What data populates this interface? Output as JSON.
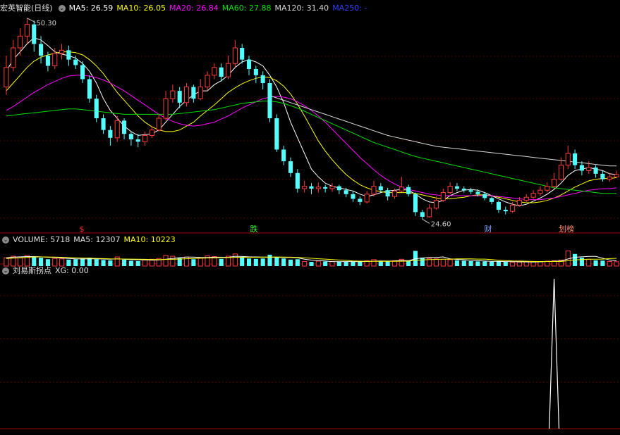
{
  "price_panel": {
    "title": "宏英智能(日线)",
    "indicators": [
      {
        "label": "MA5: 26.59",
        "color": "#ffffff"
      },
      {
        "label": "MA10: 26.05",
        "color": "#ffff00"
      },
      {
        "label": "MA20: 26.84",
        "color": "#ff00ff"
      },
      {
        "label": "MA60: 27.88",
        "color": "#00e000"
      },
      {
        "label": "MA120: 31.40",
        "color": "#d8d8d8"
      },
      {
        "label": "MA250: -",
        "color": "#3040ff"
      }
    ],
    "max_label": "50.30",
    "min_label": "24.60",
    "event_markers": [
      "$",
      "跌",
      "财",
      "划榜"
    ]
  },
  "volume_panel": {
    "title": "VOLUME: 5718",
    "ma5": "MA5: 12307",
    "ma10": "MA10: 10223"
  },
  "indicator_panel": {
    "title": "刘易斯拐点",
    "value": "XG: 0.00"
  },
  "chart_data": {
    "type": "candlestick",
    "ylim": [
      24,
      51
    ],
    "candles": [
      [
        41.5,
        44.0,
        45.5,
        40.5
      ],
      [
        44.0,
        46.5,
        47.5,
        43.5
      ],
      [
        46.5,
        48.0,
        49.0,
        45.5
      ],
      [
        48.0,
        49.5,
        50.3,
        47.0
      ],
      [
        49.5,
        47.0,
        50.0,
        46.0
      ],
      [
        47.0,
        45.5,
        48.0,
        44.5
      ],
      [
        45.5,
        44.2,
        46.0,
        43.5
      ],
      [
        44.2,
        45.8,
        46.5,
        43.8
      ],
      [
        45.8,
        46.2,
        47.0,
        45.0
      ],
      [
        46.2,
        45.0,
        46.8,
        44.2
      ],
      [
        45.0,
        44.3,
        45.5,
        43.8
      ],
      [
        44.3,
        42.5,
        44.8,
        42.0
      ],
      [
        42.5,
        40.0,
        43.0,
        39.5
      ],
      [
        40.0,
        37.5,
        40.5,
        37.0
      ],
      [
        37.5,
        36.0,
        38.0,
        35.5
      ],
      [
        36.0,
        35.0,
        36.5,
        34.0
      ],
      [
        35.0,
        37.2,
        37.8,
        34.5
      ],
      [
        37.2,
        35.5,
        37.5,
        34.8
      ],
      [
        35.5,
        34.8,
        35.8,
        34.0
      ],
      [
        34.8,
        34.5,
        35.5,
        33.8
      ],
      [
        34.5,
        35.3,
        35.8,
        34.0
      ],
      [
        35.3,
        36.0,
        36.5,
        35.0
      ],
      [
        36.0,
        37.5,
        38.0,
        35.8
      ],
      [
        37.5,
        40.0,
        41.0,
        37.2
      ],
      [
        40.0,
        41.0,
        41.8,
        39.5
      ],
      [
        41.0,
        39.5,
        41.5,
        38.8
      ],
      [
        39.5,
        41.5,
        42.0,
        39.0
      ],
      [
        41.5,
        40.0,
        41.8,
        39.5
      ],
      [
        40.0,
        41.5,
        42.5,
        39.8
      ],
      [
        41.5,
        43.0,
        43.5,
        41.0
      ],
      [
        43.0,
        44.0,
        44.5,
        42.5
      ],
      [
        44.0,
        42.8,
        44.5,
        42.2
      ],
      [
        42.8,
        44.5,
        45.5,
        42.5
      ],
      [
        44.5,
        46.5,
        47.5,
        44.0
      ],
      [
        46.5,
        45.0,
        47.0,
        44.5
      ],
      [
        45.0,
        43.8,
        45.5,
        43.0
      ],
      [
        43.8,
        43.0,
        44.2,
        42.0
      ],
      [
        43.0,
        42.0,
        43.5,
        41.2
      ],
      [
        42.0,
        37.5,
        42.5,
        37.0
      ],
      [
        37.5,
        33.5,
        38.0,
        33.2
      ],
      [
        33.5,
        32.0,
        34.0,
        31.5
      ],
      [
        32.0,
        30.5,
        32.5,
        30.0
      ],
      [
        30.5,
        28.5,
        31.0,
        28.0
      ],
      [
        28.5,
        28.8,
        29.5,
        28.0
      ],
      [
        28.8,
        28.5,
        29.2,
        27.8
      ],
      [
        28.5,
        28.7,
        29.3,
        28.0
      ],
      [
        28.7,
        28.5,
        29.0,
        28.0
      ],
      [
        28.5,
        28.8,
        29.2,
        28.1
      ],
      [
        28.8,
        28.3,
        29.0,
        27.8
      ],
      [
        28.3,
        27.8,
        28.6,
        27.4
      ],
      [
        27.8,
        27.2,
        28.2,
        26.8
      ],
      [
        27.2,
        26.8,
        27.5,
        26.4
      ],
      [
        26.8,
        27.8,
        28.2,
        26.6
      ],
      [
        27.8,
        28.8,
        29.5,
        27.5
      ],
      [
        28.8,
        28.3,
        29.2,
        28.0
      ],
      [
        28.3,
        27.5,
        28.6,
        27.0
      ],
      [
        27.5,
        28.2,
        28.5,
        27.2
      ],
      [
        28.2,
        28.7,
        30.0,
        28.0
      ],
      [
        28.7,
        27.8,
        29.0,
        27.5
      ],
      [
        27.8,
        25.5,
        28.0,
        25.0
      ],
      [
        25.5,
        24.9,
        25.8,
        24.6
      ],
      [
        24.9,
        26.0,
        26.5,
        24.8
      ],
      [
        26.0,
        27.0,
        27.5,
        25.8
      ],
      [
        27.0,
        28.0,
        28.5,
        26.8
      ],
      [
        28.0,
        28.8,
        29.3,
        27.8
      ],
      [
        28.8,
        28.5,
        29.2,
        28.2
      ],
      [
        28.5,
        28.3,
        28.8,
        28.0
      ],
      [
        28.3,
        28.1,
        28.6,
        27.8
      ],
      [
        28.1,
        27.8,
        28.4,
        27.5
      ],
      [
        27.8,
        27.3,
        28.0,
        27.0
      ],
      [
        27.3,
        26.8,
        27.5,
        26.5
      ],
      [
        26.8,
        25.8,
        27.0,
        25.4
      ],
      [
        25.8,
        25.6,
        26.2,
        25.2
      ],
      [
        25.6,
        26.4,
        26.8,
        25.4
      ],
      [
        26.4,
        27.0,
        27.4,
        26.2
      ],
      [
        27.0,
        27.4,
        27.8,
        26.8
      ],
      [
        27.4,
        27.9,
        28.3,
        27.2
      ],
      [
        27.9,
        28.3,
        28.8,
        27.6
      ],
      [
        28.3,
        28.8,
        29.3,
        28.0
      ],
      [
        28.8,
        29.7,
        30.5,
        28.5
      ],
      [
        29.7,
        31.5,
        32.5,
        29.5
      ],
      [
        31.5,
        33.0,
        34.0,
        31.0
      ],
      [
        33.0,
        31.5,
        33.5,
        31.0
      ],
      [
        31.5,
        30.8,
        32.0,
        30.2
      ],
      [
        30.8,
        31.2,
        32.0,
        30.4
      ],
      [
        31.2,
        30.4,
        31.5,
        29.9
      ],
      [
        30.4,
        29.7,
        30.8,
        29.4
      ],
      [
        29.7,
        30.0,
        30.5,
        29.4
      ],
      [
        30.0,
        30.3,
        30.8,
        29.9
      ]
    ],
    "ma": {
      "MA5": [
        43.5,
        45.0,
        46.0,
        47.0,
        47.8,
        47.5,
        46.8,
        46.0,
        45.7,
        45.5,
        45.2,
        44.5,
        43.5,
        42.0,
        40.0,
        38.5,
        37.5,
        36.5,
        35.8,
        35.3,
        35.4,
        35.5,
        36.0,
        37.0,
        38.0,
        39.0,
        39.8,
        40.5,
        41.0,
        41.0,
        41.8,
        42.3,
        43.0,
        44.0,
        44.7,
        45.0,
        44.7,
        44.2,
        43.0,
        41.5,
        39.5,
        37.0,
        35.0,
        33.0,
        31.0,
        30.0,
        29.2,
        28.8,
        28.6,
        28.4,
        28.2,
        27.8,
        27.5,
        27.7,
        28.0,
        28.2,
        28.3,
        28.4,
        28.3,
        27.8,
        27.2,
        26.8,
        26.7,
        27.0,
        27.6,
        28.0,
        28.3,
        28.4,
        28.3,
        28.0,
        27.6,
        27.2,
        26.8,
        26.5,
        26.3,
        26.5,
        26.9,
        27.3,
        27.8,
        28.4,
        29.2,
        30.2,
        30.8,
        31.0,
        31.2,
        31.0,
        30.8,
        30.4,
        30.3
      ],
      "MA10": [
        41.0,
        42.0,
        43.0,
        44.0,
        44.8,
        45.3,
        45.6,
        45.8,
        46.0,
        46.0,
        45.9,
        45.6,
        45.0,
        44.2,
        43.2,
        42.0,
        40.8,
        39.8,
        38.8,
        37.8,
        37.0,
        36.4,
        36.0,
        35.8,
        35.8,
        36.0,
        36.5,
        37.0,
        37.8,
        38.5,
        39.2,
        40.0,
        40.8,
        41.4,
        41.9,
        42.3,
        42.6,
        42.8,
        42.7,
        42.3,
        41.6,
        40.6,
        39.3,
        37.8,
        36.2,
        34.6,
        33.3,
        32.2,
        31.2,
        30.3,
        29.6,
        29.0,
        28.6,
        28.3,
        28.1,
        28.0,
        28.0,
        28.0,
        28.0,
        27.9,
        27.7,
        27.5,
        27.3,
        27.2,
        27.2,
        27.3,
        27.4,
        27.6,
        27.7,
        27.7,
        27.6,
        27.4,
        27.2,
        27.0,
        26.8,
        26.7,
        26.7,
        26.8,
        27.0,
        27.3,
        27.7,
        28.2,
        28.7,
        29.1,
        29.5,
        29.7,
        29.8,
        29.8,
        29.9
      ],
      "MA20": [
        38.5,
        39.0,
        39.6,
        40.2,
        40.8,
        41.3,
        41.8,
        42.2,
        42.6,
        42.9,
        43.0,
        43.0,
        42.9,
        42.7,
        42.4,
        42.0,
        41.5,
        41.0,
        40.4,
        39.8,
        39.2,
        38.6,
        38.0,
        37.5,
        37.1,
        36.8,
        36.6,
        36.5,
        36.6,
        36.8,
        37.0,
        37.4,
        37.8,
        38.3,
        38.8,
        39.2,
        39.6,
        40.0,
        40.2,
        40.3,
        40.2,
        40.0,
        39.6,
        39.1,
        38.5,
        37.8,
        37.0,
        36.1,
        35.2,
        34.3,
        33.4,
        32.5,
        31.7,
        30.9,
        30.2,
        29.6,
        29.1,
        28.7,
        28.4,
        28.2,
        28.0,
        27.8,
        27.7,
        27.6,
        27.6,
        27.6,
        27.6,
        27.6,
        27.6,
        27.6,
        27.6,
        27.5,
        27.4,
        27.3,
        27.2,
        27.1,
        27.1,
        27.1,
        27.2,
        27.3,
        27.5,
        27.7,
        27.9,
        28.1,
        28.3,
        28.4,
        28.5,
        28.5,
        28.6
      ],
      "MA60": [
        37.8,
        37.9,
        38.0,
        38.1,
        38.2,
        38.3,
        38.4,
        38.5,
        38.6,
        38.7,
        38.7,
        38.6,
        38.5,
        38.4,
        38.3,
        38.2,
        38.1,
        38.0,
        38.0,
        38.0,
        38.0,
        38.0,
        38.0,
        38.0,
        38.0,
        38.1,
        38.2,
        38.3,
        38.4,
        38.5,
        38.6,
        38.8,
        39.0,
        39.2,
        39.4,
        39.5,
        39.6,
        39.7,
        39.7,
        39.6,
        39.4,
        39.1,
        38.8,
        38.4,
        38.0,
        37.6,
        37.2,
        36.8,
        36.4,
        36.0,
        35.6,
        35.2,
        34.8,
        34.4,
        34.1,
        33.8,
        33.5,
        33.2,
        32.9,
        32.6,
        32.4,
        32.2,
        32.0,
        31.8,
        31.6,
        31.4,
        31.2,
        31.0,
        30.8,
        30.6,
        30.4,
        30.2,
        30.0,
        29.8,
        29.6,
        29.4,
        29.2,
        29.0,
        28.8,
        28.6,
        28.5,
        28.4,
        28.3,
        28.2,
        28.1,
        28.0,
        27.9,
        27.9,
        27.9
      ],
      "MA120": [
        null,
        null,
        null,
        null,
        null,
        null,
        null,
        null,
        null,
        null,
        null,
        null,
        null,
        null,
        null,
        null,
        null,
        null,
        null,
        null,
        null,
        null,
        null,
        null,
        null,
        null,
        null,
        null,
        null,
        null,
        null,
        null,
        null,
        null,
        null,
        null,
        null,
        null,
        40.4,
        40.1,
        39.8,
        39.5,
        39.2,
        38.9,
        38.6,
        38.3,
        38.0,
        37.7,
        37.4,
        37.1,
        36.8,
        36.5,
        36.2,
        35.9,
        35.6,
        35.3,
        35.1,
        34.9,
        34.7,
        34.5,
        34.3,
        34.1,
        33.9,
        33.8,
        33.7,
        33.6,
        33.5,
        33.4,
        33.3,
        33.2,
        33.1,
        33.0,
        32.9,
        32.8,
        32.7,
        32.6,
        32.5,
        32.4,
        32.3,
        32.2,
        32.1,
        32.0,
        31.9,
        31.8,
        31.7,
        31.6,
        31.5,
        31.4,
        31.4
      ]
    },
    "volume": {
      "ylim": [
        0,
        26000
      ],
      "values": [
        11000,
        13000,
        12000,
        14000,
        12500,
        11000,
        9000,
        10000,
        9500,
        8500,
        9000,
        10000,
        11000,
        9000,
        8000,
        7500,
        12000,
        8500,
        7000,
        6500,
        8000,
        9000,
        10000,
        14000,
        13000,
        10500,
        12000,
        9000,
        11000,
        13500,
        12500,
        9500,
        13000,
        16000,
        12000,
        10000,
        9500,
        10000,
        15000,
        12000,
        10000,
        8500,
        9000,
        6000,
        5500,
        6500,
        6000,
        6200,
        5800,
        5500,
        6000,
        5600,
        7000,
        8500,
        6800,
        6000,
        7200,
        9000,
        6500,
        20000,
        11000,
        10000,
        9500,
        9000,
        8500,
        7500,
        7000,
        6500,
        6200,
        6000,
        5800,
        6500,
        5500,
        5000,
        5200,
        5600,
        5800,
        6000,
        6500,
        7000,
        8000,
        20000,
        16000,
        11000,
        9000,
        7500,
        7200,
        6000,
        5718
      ],
      "ma5": [
        11000,
        11800,
        12200,
        12500,
        12500,
        12200,
        11600,
        11300,
        10600,
        10000,
        9600,
        9400,
        9600,
        9500,
        9300,
        9100,
        9500,
        9000,
        8600,
        8300,
        8400,
        7800,
        8100,
        9100,
        10000,
        11100,
        11800,
        11900,
        11300,
        11200,
        11700,
        11700,
        11500,
        12900,
        12600,
        12200,
        12100,
        11900,
        11700,
        11600,
        11400,
        11300,
        10900,
        9100,
        7900,
        7100,
        6700,
        5900,
        5800,
        5900,
        5900,
        5800,
        6000,
        6500,
        6800,
        6600,
        6700,
        7500,
        7100,
        9700,
        10700,
        11300,
        11300,
        12100,
        9600,
        8800,
        8300,
        7800,
        7100,
        6600,
        6300,
        6200,
        5900,
        5800,
        5700,
        5500,
        5400,
        5600,
        6000,
        6400,
        6700,
        9400,
        11600,
        12200,
        12800,
        12700,
        10300,
        8100,
        7000
      ],
      "ma10": [
        10000,
        10500,
        11000,
        11500,
        12000,
        12100,
        12000,
        11800,
        11500,
        11200,
        10900,
        10600,
        10400,
        10100,
        9800,
        9500,
        9400,
        9300,
        9200,
        9000,
        8900,
        8600,
        8600,
        8700,
        8900,
        9300,
        9700,
        10000,
        10300,
        10700,
        10900,
        11100,
        11200,
        11600,
        11600,
        11600,
        11600,
        11700,
        11800,
        12000,
        11900,
        11700,
        11400,
        11000,
        10300,
        9700,
        9200,
        8600,
        8000,
        7500,
        6800,
        6500,
        6300,
        6200,
        6300,
        6200,
        6200,
        6400,
        6500,
        7500,
        8100,
        8500,
        8800,
        9100,
        9100,
        9500,
        9600,
        9500,
        9200,
        9200,
        8500,
        7700,
        7200,
        6800,
        6600,
        6400,
        6100,
        6000,
        6000,
        6000,
        6000,
        7100,
        8100,
        8600,
        9000,
        9100,
        9200,
        9800,
        10200
      ]
    },
    "indicator": {
      "ylim": [
        0,
        1
      ],
      "values": [
        0,
        0,
        0,
        0,
        0,
        0,
        0,
        0,
        0,
        0,
        0,
        0,
        0,
        0,
        0,
        0,
        0,
        0,
        0,
        0,
        0,
        0,
        0,
        0,
        0,
        0,
        0,
        0,
        0,
        0,
        0,
        0,
        0,
        0,
        0,
        0,
        0,
        0,
        0,
        0,
        0,
        0,
        0,
        0,
        0,
        0,
        0,
        0,
        0,
        0,
        0,
        0,
        0,
        0,
        0,
        0,
        0,
        0,
        0,
        0,
        0,
        0,
        0,
        0,
        0,
        0,
        0,
        0,
        0,
        0,
        0,
        0,
        0,
        0,
        0,
        0,
        0,
        0,
        0,
        1,
        0,
        0,
        0,
        0,
        0,
        0,
        0,
        0,
        0
      ]
    }
  }
}
